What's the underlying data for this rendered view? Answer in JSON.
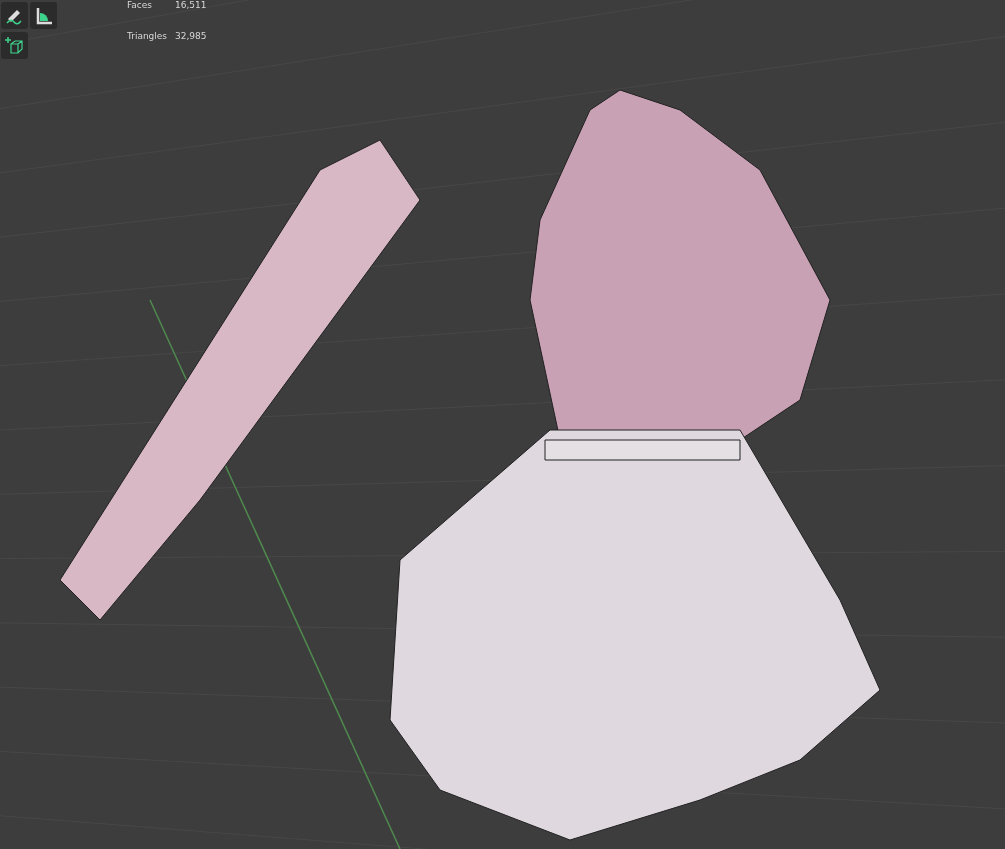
{
  "stats": [
    {
      "label": "Faces",
      "value": "16,511"
    },
    {
      "label": "Triangles",
      "value": "32,985"
    }
  ],
  "tools": [
    {
      "kind": "annotate",
      "selected": false
    },
    {
      "kind": "measure",
      "selected": false
    },
    {
      "kind": "add-cube",
      "selected": false
    }
  ]
}
